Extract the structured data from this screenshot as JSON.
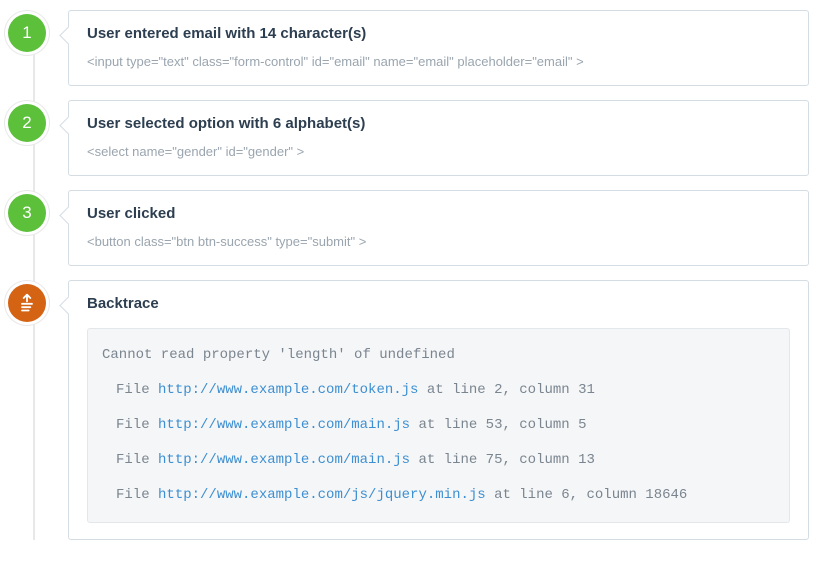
{
  "steps": [
    {
      "num": "1",
      "title": "User entered email with 14 character(s)",
      "code": "<input type=\"text\" class=\"form-control\" id=\"email\" name=\"email\" placeholder=\"email\" >"
    },
    {
      "num": "2",
      "title": "User selected option with 6 alphabet(s)",
      "code": "<select name=\"gender\" id=\"gender\" >"
    },
    {
      "num": "3",
      "title": "User clicked",
      "code": "<button class=\"btn btn-success\" type=\"submit\" >"
    }
  ],
  "backtrace": {
    "title": "Backtrace",
    "error": "Cannot read property 'length' of undefined",
    "file_prefix": "File ",
    "lines": [
      {
        "url": "http://www.example.com/token.js",
        "suffix": " at line 2, column 31"
      },
      {
        "url": "http://www.example.com/main.js",
        "suffix": " at line 53, column 5"
      },
      {
        "url": "http://www.example.com/main.js",
        "suffix": " at line 75, column 13"
      },
      {
        "url": "http://www.example.com/js/jquery.min.js",
        "suffix": " at line 6, column 18646"
      }
    ]
  }
}
